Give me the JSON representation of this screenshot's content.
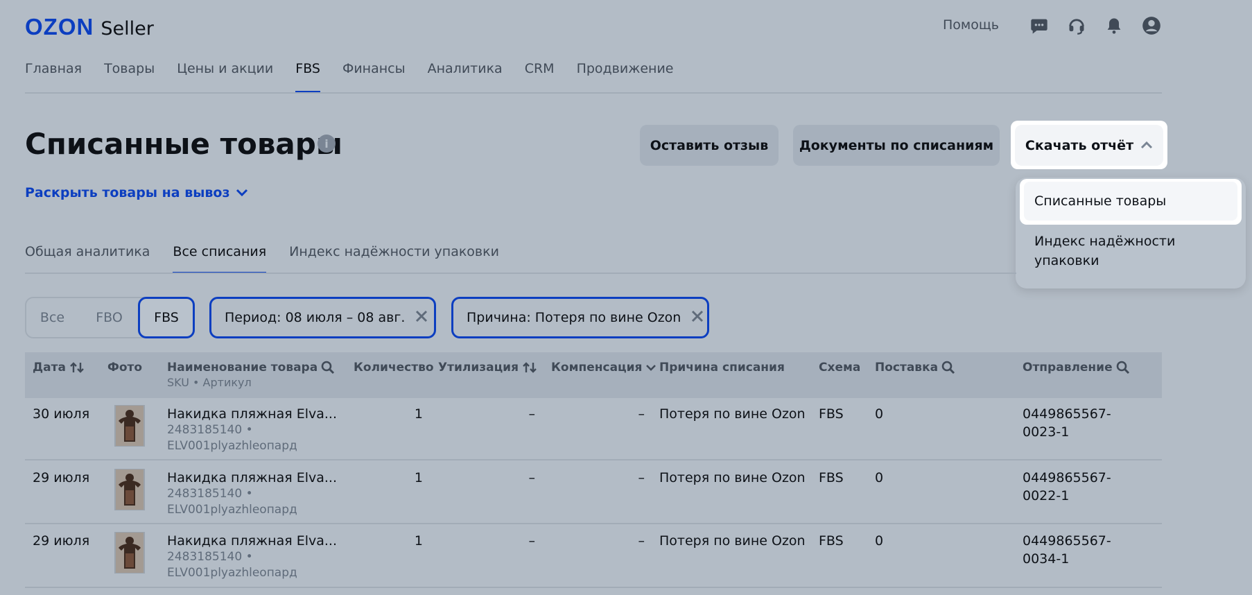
{
  "header": {
    "logo_brand": "OZON",
    "logo_product": "Seller",
    "help": "Помощь",
    "icons": [
      "chat-icon",
      "headset-icon",
      "bell-icon",
      "profile-icon"
    ]
  },
  "nav": {
    "items": [
      "Главная",
      "Товары",
      "Цены и акции",
      "FBS",
      "Финансы",
      "Аналитика",
      "CRM",
      "Продвижение"
    ],
    "active": "FBS"
  },
  "page": {
    "title": "Списанные товары",
    "info": "i",
    "expand_link": "Раскрыть товары на вывоз"
  },
  "actions": {
    "review": "Оставить отзыв",
    "documents": "Документы по списаниям",
    "report": "Скачать отчёт"
  },
  "dropdown": {
    "items": [
      "Списанные товары",
      "Индекс надёжности упаковки"
    ]
  },
  "subtabs": {
    "items": [
      "Общая аналитика",
      "Все списания",
      "Индекс надёжности упаковки"
    ],
    "active": "Все списания"
  },
  "filters": {
    "segments": [
      "Все",
      "FBO",
      "FBS"
    ],
    "selected": "FBS",
    "period": "Период: 08 июля – 08 авг.",
    "reason": "Причина: Потеря по вине Ozon"
  },
  "table": {
    "headers": {
      "date": "Дата",
      "photo": "Фото",
      "name": "Наименование товара",
      "name_sub": "SKU • Артикул",
      "quantity": "Количество",
      "utilization": "Утилизация",
      "compensation": "Компенсация",
      "reason": "Причина списания",
      "scheme": "Схема",
      "supply": "Поставка",
      "shipment": "Отправление"
    },
    "rows": [
      {
        "date": "30 июля",
        "name": "Накидка пляжная Elva...",
        "sku": "2483185140 •",
        "article": "ELV001plyazhleопард",
        "quantity": "1",
        "utilization": "–",
        "compensation": "–",
        "reason": "Потеря по вине Ozon",
        "scheme": "FBS",
        "supply": "0",
        "shipment_1": "0449865567-",
        "shipment_2": "0023-1"
      },
      {
        "date": "29 июля",
        "name": "Накидка пляжная Elva...",
        "sku": "2483185140 •",
        "article": "ELV001plyazhleопард",
        "quantity": "1",
        "utilization": "–",
        "compensation": "–",
        "reason": "Потеря по вине Ozon",
        "scheme": "FBS",
        "supply": "0",
        "shipment_1": "0449865567-",
        "shipment_2": "0022-1"
      },
      {
        "date": "29 июля",
        "name": "Накидка пляжная Elva...",
        "sku": "2483185140 •",
        "article": "ELV001plyazhleопард",
        "quantity": "1",
        "utilization": "–",
        "compensation": "–",
        "reason": "Потеря по вине Ozon",
        "scheme": "FBS",
        "supply": "0",
        "shipment_1": "0449865567-",
        "shipment_2": "0034-1"
      }
    ]
  }
}
